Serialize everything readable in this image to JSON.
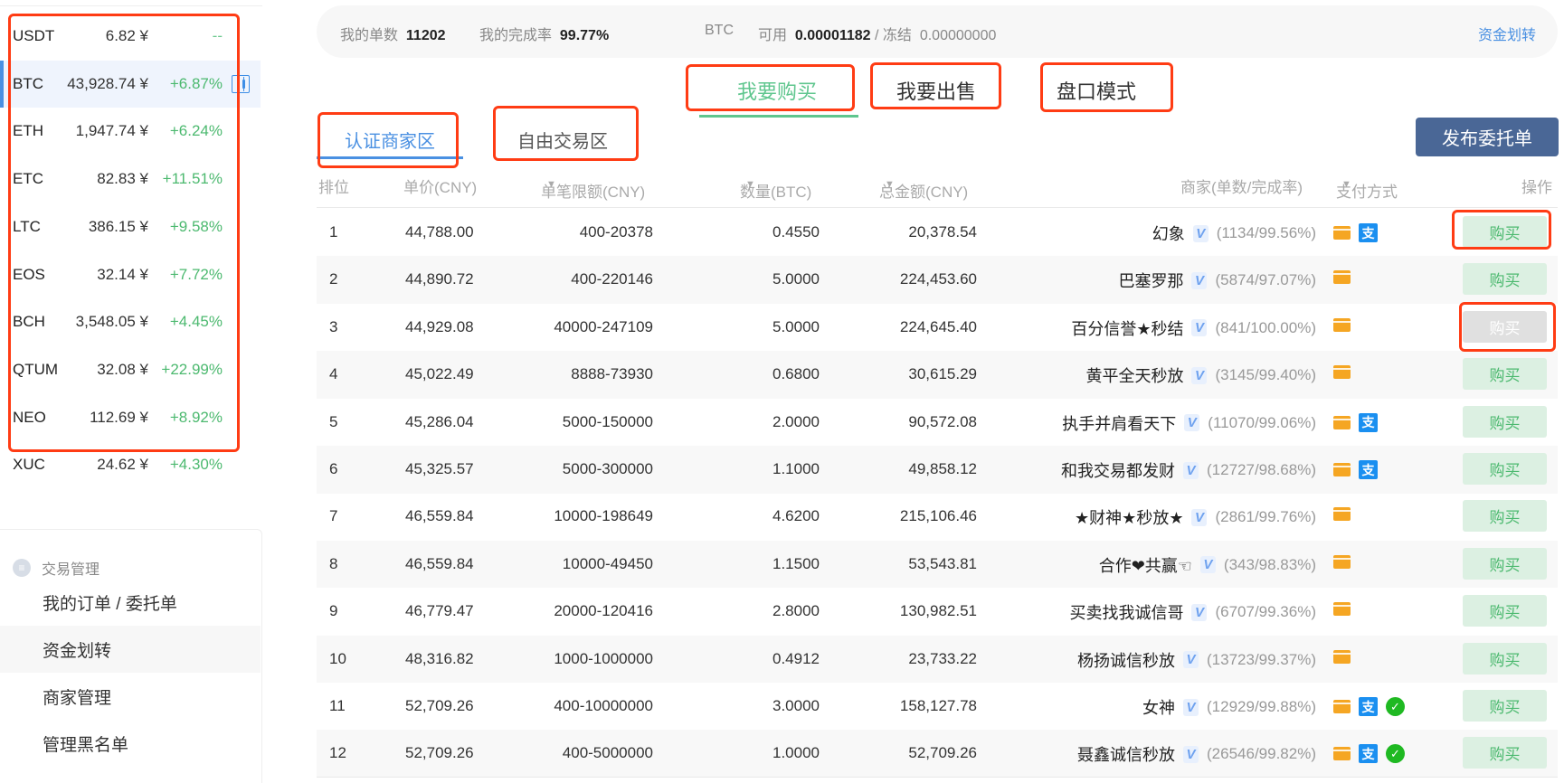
{
  "coins": [
    {
      "symbol": "USDT",
      "price": "6.82 ¥",
      "change": "--"
    },
    {
      "symbol": "BTC",
      "price": "43,928.74 ¥",
      "change": "+6.87%",
      "active": true
    },
    {
      "symbol": "ETH",
      "price": "1,947.74 ¥",
      "change": "+6.24%"
    },
    {
      "symbol": "ETC",
      "price": "82.83 ¥",
      "change": "+11.51%"
    },
    {
      "symbol": "LTC",
      "price": "386.15 ¥",
      "change": "+9.58%"
    },
    {
      "symbol": "EOS",
      "price": "32.14 ¥",
      "change": "+7.72%"
    },
    {
      "symbol": "BCH",
      "price": "3,548.05 ¥",
      "change": "+4.45%"
    },
    {
      "symbol": "QTUM",
      "price": "32.08 ¥",
      "change": "+22.99%"
    },
    {
      "symbol": "NEO",
      "price": "112.69 ¥",
      "change": "+8.92%"
    },
    {
      "symbol": "XUC",
      "price": "24.62 ¥",
      "change": "+4.30%"
    }
  ],
  "menu": {
    "group_label": "交易管理",
    "group_icon": "list-icon",
    "items": [
      {
        "label": "我的订单 / 委托单"
      },
      {
        "label": "资金划转",
        "hover": true
      },
      {
        "label": "商家管理"
      },
      {
        "label": "管理黑名单"
      }
    ]
  },
  "summary": {
    "orders_label": "我的单数",
    "orders_value": "11202",
    "rate_label": "我的完成率",
    "rate_value": "99.77%",
    "asset": "BTC",
    "available_label": "可用",
    "available_value": "0.00001182",
    "separator": "/",
    "frozen_label": "冻结",
    "frozen_value": "0.00000000",
    "transfer_link": "资金划转"
  },
  "mode_tabs": [
    {
      "label": "我要购买",
      "active": true
    },
    {
      "label": "我要出售"
    },
    {
      "label": "盘口模式"
    }
  ],
  "zone_tabs": [
    {
      "label": "认证商家区",
      "active": true
    },
    {
      "label": "自由交易区"
    }
  ],
  "publish_button": "发布委托单",
  "table": {
    "headers": {
      "rank": "排位",
      "price": "单价(CNY)",
      "limit": "单笔限额(CNY)",
      "qty": "数量(BTC)",
      "total": "总金额(CNY)",
      "merchant": "商家(单数/完成率)",
      "payment": "支付方式",
      "action": "操作"
    },
    "sort_icon": "▼",
    "verified_badge": "V",
    "buy_label": "购买",
    "rows": [
      {
        "rank": "1",
        "price": "44,788.00",
        "limit": "400-20378",
        "qty": "0.4550",
        "total": "20,378.54",
        "merchant": "幻象",
        "stats": "(1134/99.56%)",
        "payments": [
          "bank-card",
          "alipay"
        ],
        "disabled": false
      },
      {
        "rank": "2",
        "price": "44,890.72",
        "limit": "400-220146",
        "qty": "5.0000",
        "total": "224,453.60",
        "merchant": "巴塞罗那",
        "stats": "(5874/97.07%)",
        "payments": [
          "bank-card"
        ],
        "disabled": false
      },
      {
        "rank": "3",
        "price": "44,929.08",
        "limit": "40000-247109",
        "qty": "5.0000",
        "total": "224,645.40",
        "merchant": "百分信誉★秒结",
        "stats": "(841/100.00%)",
        "payments": [
          "bank-card"
        ],
        "disabled": true
      },
      {
        "rank": "4",
        "price": "45,022.49",
        "limit": "8888-73930",
        "qty": "0.6800",
        "total": "30,615.29",
        "merchant": "黄平全天秒放",
        "stats": "(3145/99.40%)",
        "payments": [
          "bank-card"
        ],
        "disabled": false
      },
      {
        "rank": "5",
        "price": "45,286.04",
        "limit": "5000-150000",
        "qty": "2.0000",
        "total": "90,572.08",
        "merchant": "执手并肩看天下",
        "stats": "(11070/99.06%)",
        "payments": [
          "bank-card",
          "alipay"
        ],
        "disabled": false
      },
      {
        "rank": "6",
        "price": "45,325.57",
        "limit": "5000-300000",
        "qty": "1.1000",
        "total": "49,858.12",
        "merchant": "和我交易都发财",
        "stats": "(12727/98.68%)",
        "payments": [
          "bank-card",
          "alipay"
        ],
        "disabled": false
      },
      {
        "rank": "7",
        "price": "46,559.84",
        "limit": "10000-198649",
        "qty": "4.6200",
        "total": "215,106.46",
        "merchant": "★财神★秒放★",
        "stats": "(2861/99.76%)",
        "payments": [
          "bank-card"
        ],
        "disabled": false
      },
      {
        "rank": "8",
        "price": "46,559.84",
        "limit": "10000-49450",
        "qty": "1.1500",
        "total": "53,543.81",
        "merchant": "合作❤共赢☜",
        "stats": "(343/98.83%)",
        "payments": [
          "bank-card"
        ],
        "disabled": false
      },
      {
        "rank": "9",
        "price": "46,779.47",
        "limit": "20000-120416",
        "qty": "2.8000",
        "total": "130,982.51",
        "merchant": "买卖找我诚信哥",
        "stats": "(6707/99.36%)",
        "payments": [
          "bank-card"
        ],
        "disabled": false
      },
      {
        "rank": "10",
        "price": "48,316.82",
        "limit": "1000-1000000",
        "qty": "0.4912",
        "total": "23,733.22",
        "merchant": "杨扬诚信秒放",
        "stats": "(13723/99.37%)",
        "payments": [
          "bank-card"
        ],
        "disabled": false
      },
      {
        "rank": "11",
        "price": "52,709.26",
        "limit": "400-10000000",
        "qty": "3.0000",
        "total": "158,127.78",
        "merchant": "女神",
        "stats": "(12929/99.88%)",
        "payments": [
          "bank-card",
          "alipay",
          "wechat"
        ],
        "disabled": false
      },
      {
        "rank": "12",
        "price": "52,709.26",
        "limit": "400-5000000",
        "qty": "1.0000",
        "total": "52,709.26",
        "merchant": "聂鑫诚信秒放",
        "stats": "(26546/99.82%)",
        "payments": [
          "bank-card",
          "alipay",
          "wechat"
        ],
        "disabled": false
      }
    ]
  },
  "colors": {
    "positive": "#4cb96f",
    "link": "#4a90e2",
    "publish": "#4a6796",
    "annotation": "#ff3c14"
  }
}
